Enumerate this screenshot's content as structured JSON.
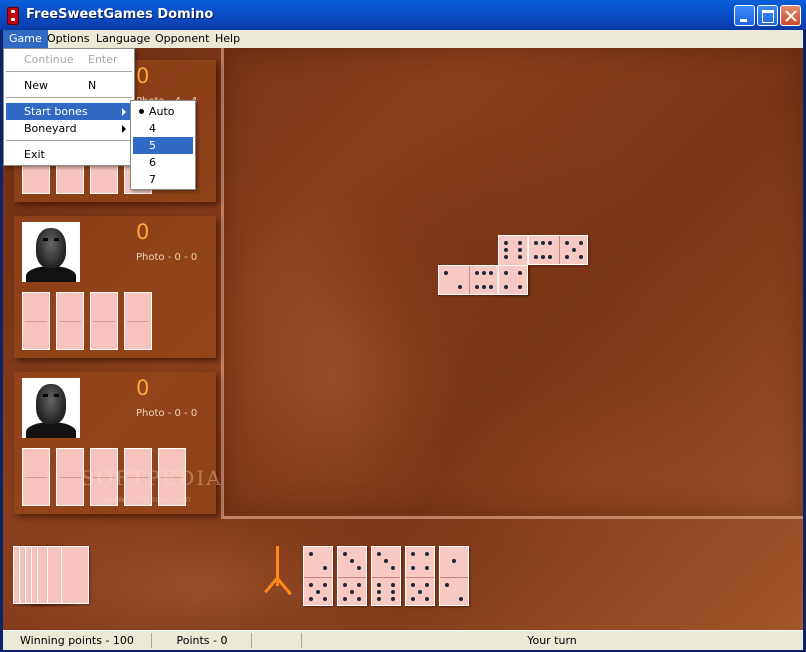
{
  "window": {
    "title": "FreeSweetGames Domino"
  },
  "menubar": {
    "items": [
      {
        "label": "Game"
      },
      {
        "label": "Options"
      },
      {
        "label": "Language"
      },
      {
        "label": "Opponent"
      },
      {
        "label": "Help"
      }
    ]
  },
  "game_menu": {
    "continue_label": "Continue",
    "continue_shortcut": "Enter",
    "new_label": "New",
    "new_shortcut": "N",
    "start_bones_label": "Start bones",
    "boneyard_label": "Boneyard",
    "exit_label": "Exit"
  },
  "start_bones_menu": {
    "options": [
      "Auto",
      "4",
      "5",
      "6",
      "7"
    ],
    "checked": "Auto",
    "highlighted": "5"
  },
  "opponents": [
    {
      "score": "0",
      "stats": "Photo - 4 - 4",
      "hidden_tiles": 4
    },
    {
      "score": "0",
      "stats": "Photo - 0 - 0",
      "hidden_tiles": 4
    },
    {
      "score": "0",
      "stats": "Photo - 0 - 0",
      "hidden_tiles": 5
    }
  ],
  "board_tiles": [
    {
      "orientation": "horizontal",
      "a": 2,
      "b": 6
    },
    {
      "orientation": "vertical",
      "a": 6,
      "b": 6
    },
    {
      "orientation": "vertical",
      "a": 4,
      "b": 6
    },
    {
      "orientation": "horizontal",
      "a": 6,
      "b": 5
    }
  ],
  "player_hand": [
    {
      "a": 2,
      "b": 5
    },
    {
      "a": 3,
      "b": 5
    },
    {
      "a": 3,
      "b": 6
    },
    {
      "a": 4,
      "b": 5
    },
    {
      "a": 1,
      "b": 2
    }
  ],
  "boneyard": {
    "count": 7
  },
  "watermark": {
    "text": "SOFTPEDIA",
    "url": "www.softpedia.com"
  },
  "statusbar": {
    "winning_points": "Winning points - 100",
    "points": "Points - 0",
    "turn": "Your turn"
  },
  "colors": {
    "score": "#ffa53a",
    "tile": "#f7c9c2",
    "arrow": "#ff8a1a",
    "menu_highlight": "#316ac5",
    "titlebar": "#0a5fd8"
  }
}
